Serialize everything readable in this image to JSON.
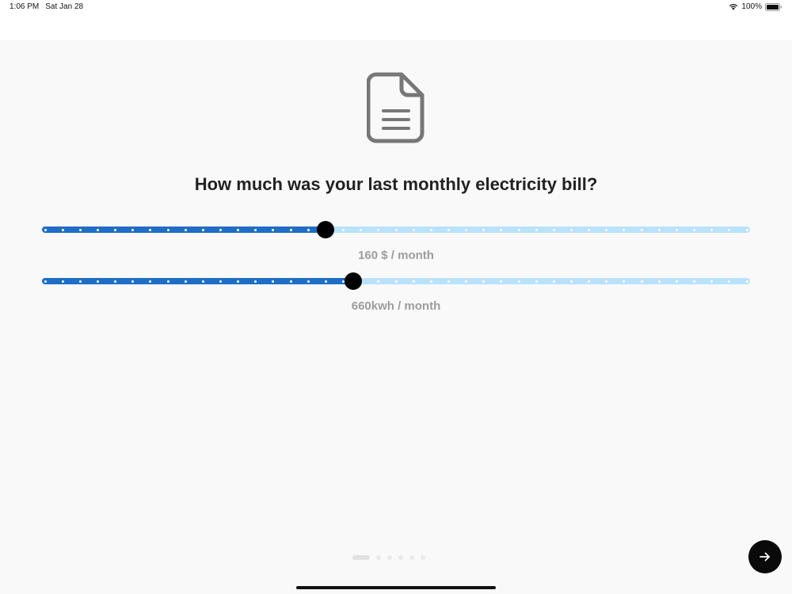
{
  "status_bar": {
    "time": "1:06 PM",
    "date": "Sat Jan 28",
    "battery": "100%",
    "wifi_icon": "wifi-icon",
    "battery_icon": "battery-icon"
  },
  "icon": "document-icon",
  "question": "How much was your last monthly electricity bill?",
  "sliders": [
    {
      "value_label": "160 $ / month",
      "fraction": 0.4
    },
    {
      "value_label": "660kwh / month",
      "fraction": 0.44
    }
  ],
  "pagination": {
    "total": 6,
    "current": 1
  },
  "next_button": {
    "icon": "arrow-right-icon"
  },
  "colors": {
    "track_active": "#1e6ec8",
    "track_inactive": "#b9e2fb",
    "thumb": "#000000",
    "button": "#0a0a0a",
    "value_text": "#9c9c9c"
  }
}
